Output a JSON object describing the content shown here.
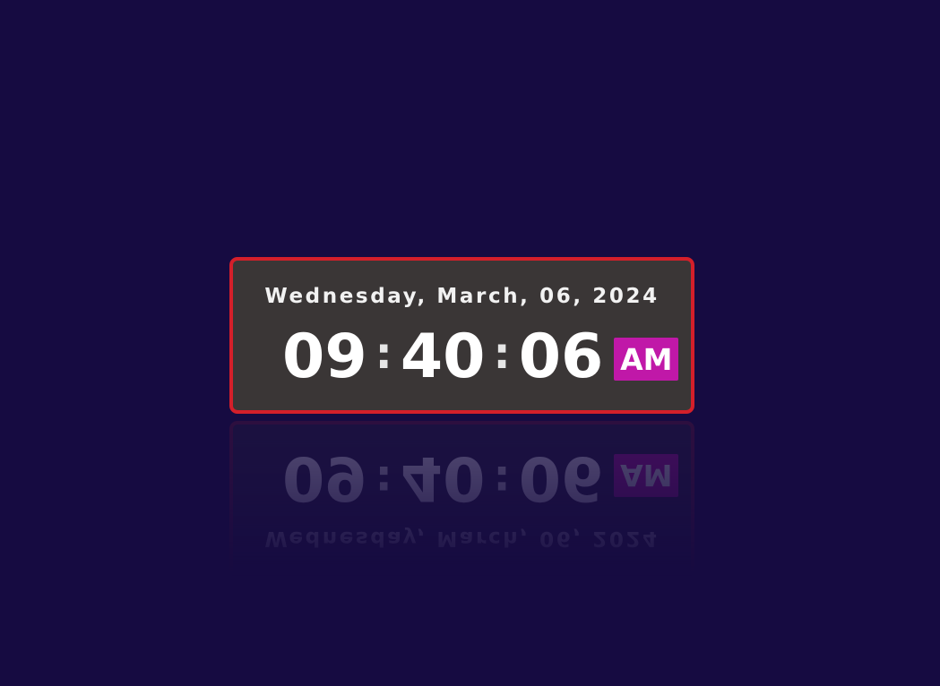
{
  "clock": {
    "date": "Wednesday, March, 06, 2024",
    "hours": "09",
    "minutes": "40",
    "seconds": "06",
    "separator": ":",
    "meridiem": "AM"
  },
  "colors": {
    "background": "#160b41",
    "panel": "#3a3636",
    "border": "#d41f2a",
    "meridiem_badge": "#c018a8",
    "text": "#ffffff"
  }
}
